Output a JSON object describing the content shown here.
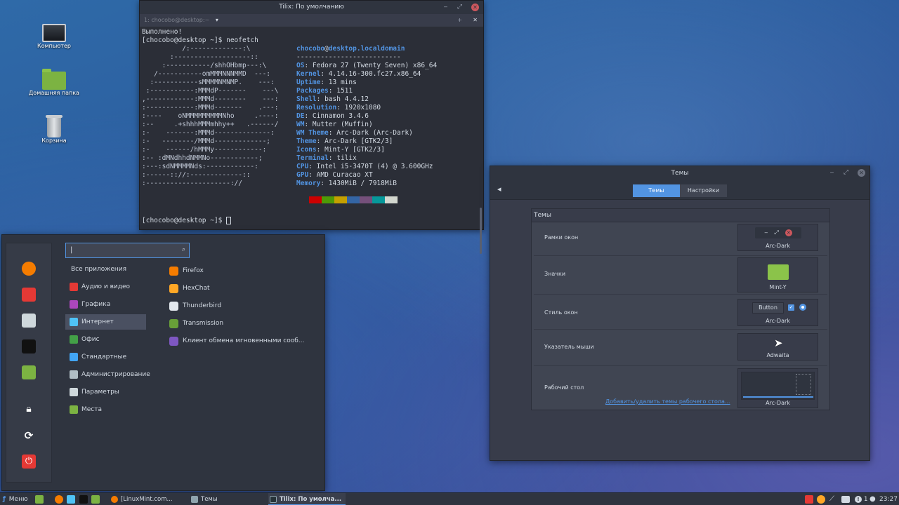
{
  "desktop": {
    "icons": [
      {
        "label": "Компьютер"
      },
      {
        "label": "Домашняя папка"
      },
      {
        "label": "Корзина"
      }
    ]
  },
  "terminal": {
    "title": "Tilix: По умолчанию",
    "tab_label": "1: chocobo@desktop:~",
    "line_done": "Выполнено!",
    "prompt_cmd": "[chocobo@desktop ~]$ neofetch",
    "prompt_end": "[chocobo@desktop ~]$ ",
    "logo": [
      "          /:-------------:\\",
      "       :-------------------::",
      "     :-----------/shhOHbmp---:\\",
      "   /-----------omMMMNNNMMD  ---:",
      "  :-----------sMMMMNMNMP.    ---:",
      " :-----------:MMMdP-------    ---\\",
      ",------------:MMMd--------    ---:",
      ":------------:MMMd-------    .---:",
      ":----    oNMMMMMMMMMNho     .----:",
      ":--     .+shhhMMMmhhy++   .------/",
      ":-    -------:MMMd--------------:",
      ":-   --------/MMMd-------------;",
      ":-    ------/hMMMy------------:",
      ":-- :dMNdhhdNMMNo------------;",
      ":---:sdNMMMMNds:------------:",
      ":------:://:-------------::",
      ":---------------------://"
    ],
    "user": "chocobo",
    "host": "desktop.localdomain",
    "separator": "--------------------------",
    "info": [
      {
        "key": "OS",
        "value": "Fedora 27 (Twenty Seven) x86_64"
      },
      {
        "key": "Kernel",
        "value": "4.14.16-300.fc27.x86_64"
      },
      {
        "key": "Uptime",
        "value": "13 mins"
      },
      {
        "key": "Packages",
        "value": "1511"
      },
      {
        "key": "Shell",
        "value": "bash 4.4.12"
      },
      {
        "key": "Resolution",
        "value": "1920x1080"
      },
      {
        "key": "DE",
        "value": "Cinnamon 3.4.6"
      },
      {
        "key": "WM",
        "value": "Mutter (Muffin)"
      },
      {
        "key": "WM Theme",
        "value": "Arc-Dark (Arc-Dark)"
      },
      {
        "key": "Theme",
        "value": "Arc-Dark [GTK2/3]"
      },
      {
        "key": "Icons",
        "value": "Mint-Y [GTK2/3]"
      },
      {
        "key": "Terminal",
        "value": "tilix"
      },
      {
        "key": "CPU",
        "value": "Intel i5-3470T (4) @ 3.600GHz"
      },
      {
        "key": "GPU",
        "value": "AMD Curacao XT"
      },
      {
        "key": "Memory",
        "value": "1430MiB / 7918MiB"
      }
    ],
    "swatch_colors": [
      "#2b2e37",
      "#cc0000",
      "#4e9a06",
      "#c4a000",
      "#3465a4",
      "#75507b",
      "#06989a",
      "#d3d7cf"
    ]
  },
  "menu": {
    "search_value": "|",
    "categories": [
      {
        "label": "Все приложения",
        "color": ""
      },
      {
        "label": "Аудио и видео",
        "color": "#e53935"
      },
      {
        "label": "Графика",
        "color": "#ab47bc"
      },
      {
        "label": "Интернет",
        "color": "#4fc3f7"
      },
      {
        "label": "Офис",
        "color": "#43a047"
      },
      {
        "label": "Стандартные",
        "color": "#42a5f5"
      },
      {
        "label": "Администрирование",
        "color": "#b0bec5"
      },
      {
        "label": "Параметры",
        "color": "#cfd8dc"
      },
      {
        "label": "Места",
        "color": "#7cb342"
      }
    ],
    "apps": [
      {
        "label": "Firefox",
        "color": "#f57c00"
      },
      {
        "label": "HexChat",
        "color": "#ffa726"
      },
      {
        "label": "Thunderbird",
        "color": "#e3e8ee"
      },
      {
        "label": "Transmission",
        "color": "#689f38"
      },
      {
        "label": "Клиент обмена мгновенными сооб...",
        "color": "#7e57c2"
      }
    ]
  },
  "themes": {
    "title": "Темы",
    "tabs": [
      "Темы",
      "Настройки"
    ],
    "panel_title": "Темы",
    "rows": [
      {
        "label": "Рамки окон",
        "value": "Arc-Dark"
      },
      {
        "label": "Значки",
        "value": "Mint-Y"
      },
      {
        "label": "Стиль окон",
        "value": "Arc-Dark"
      },
      {
        "label": "Указатель мыши",
        "value": "Adwaita"
      },
      {
        "label": "Рабочий стол",
        "value": "Arc-Dark"
      }
    ],
    "preview_button": "Button",
    "link": "Добавить/удалить темы рабочего стола..."
  },
  "taskbar": {
    "menu_label": "Меню",
    "tasks": [
      {
        "label": "[LinuxMint.com...",
        "color": "#f57c00"
      },
      {
        "label": "Темы",
        "color": "#90a4ae"
      },
      {
        "label": "Tilix: По умолча...",
        "color": "#263238"
      }
    ],
    "notifications": "1",
    "clock": "23:27"
  }
}
